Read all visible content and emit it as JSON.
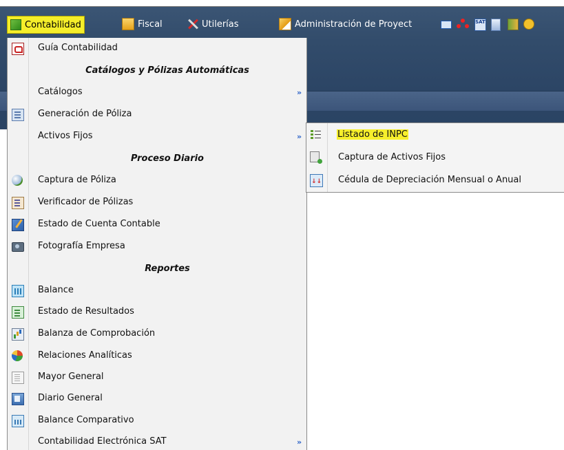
{
  "menubar": {
    "items": [
      {
        "label": "Contabilidad",
        "icon": "accounting-icon",
        "active": true
      },
      {
        "label": "Fiscal",
        "icon": "fiscal-folder-icon"
      },
      {
        "label": "Utilerías",
        "icon": "tools-icon"
      },
      {
        "label": "Administración de Proyect",
        "icon": "project-admin-icon"
      }
    ],
    "right_icons": [
      "message-icon",
      "network-icon",
      "sat-icon",
      "calculator-icon",
      "exit-icon",
      "help-icon"
    ],
    "right_icon_text": {
      "sat": "SAT"
    },
    "colors": {
      "bar": "#324c6b",
      "highlight": "#f5ee2a"
    }
  },
  "dropdown": {
    "rows": [
      {
        "type": "item",
        "label": "Guía Contabilidad",
        "icon": "pdf-icon"
      },
      {
        "type": "header",
        "label": "Catálogos y Pólizas Automáticas"
      },
      {
        "type": "item",
        "label": "Catálogos",
        "submenu": true
      },
      {
        "type": "item",
        "label": "Generación de Póliza",
        "icon": "policy-generation-icon"
      },
      {
        "type": "item",
        "label": "Activos Fijos",
        "submenu": true
      },
      {
        "type": "header",
        "label": "Proceso Diario"
      },
      {
        "type": "item",
        "label": "Captura de Póliza",
        "icon": "policy-capture-icon"
      },
      {
        "type": "item",
        "label": "Verificador de Pólizas",
        "icon": "policy-verifier-icon"
      },
      {
        "type": "item",
        "label": "Estado de Cuenta Contable",
        "icon": "account-statement-icon"
      },
      {
        "type": "item",
        "label": "Fotografía Empresa",
        "icon": "camera-icon"
      },
      {
        "type": "header",
        "label": "Reportes"
      },
      {
        "type": "item",
        "label": "Balance",
        "icon": "balance-icon"
      },
      {
        "type": "item",
        "label": "Estado de Resultados",
        "icon": "income-statement-icon"
      },
      {
        "type": "item",
        "label": "Balanza de Comprobación",
        "icon": "trial-balance-icon"
      },
      {
        "type": "item",
        "label": "Relaciones Analíticas",
        "icon": "pie-chart-icon"
      },
      {
        "type": "item",
        "label": "Mayor General",
        "icon": "general-ledger-icon"
      },
      {
        "type": "item",
        "label": "Diario General",
        "icon": "general-journal-icon"
      },
      {
        "type": "item",
        "label": "Balance Comparativo",
        "icon": "comparative-balance-icon"
      },
      {
        "type": "item",
        "label": "Contabilidad Electrónica SAT",
        "submenu": true
      }
    ],
    "submenu_arrow": "»"
  },
  "submenu": {
    "parent": "Activos Fijos",
    "items": [
      {
        "label": "Listado de INPC",
        "icon": "list-icon",
        "highlighted": true
      },
      {
        "label": "Captura de Activos Fijos",
        "icon": "asset-capture-icon"
      },
      {
        "label": "Cédula de Depreciación Mensual o Anual",
        "icon": "depreciation-icon"
      }
    ]
  }
}
